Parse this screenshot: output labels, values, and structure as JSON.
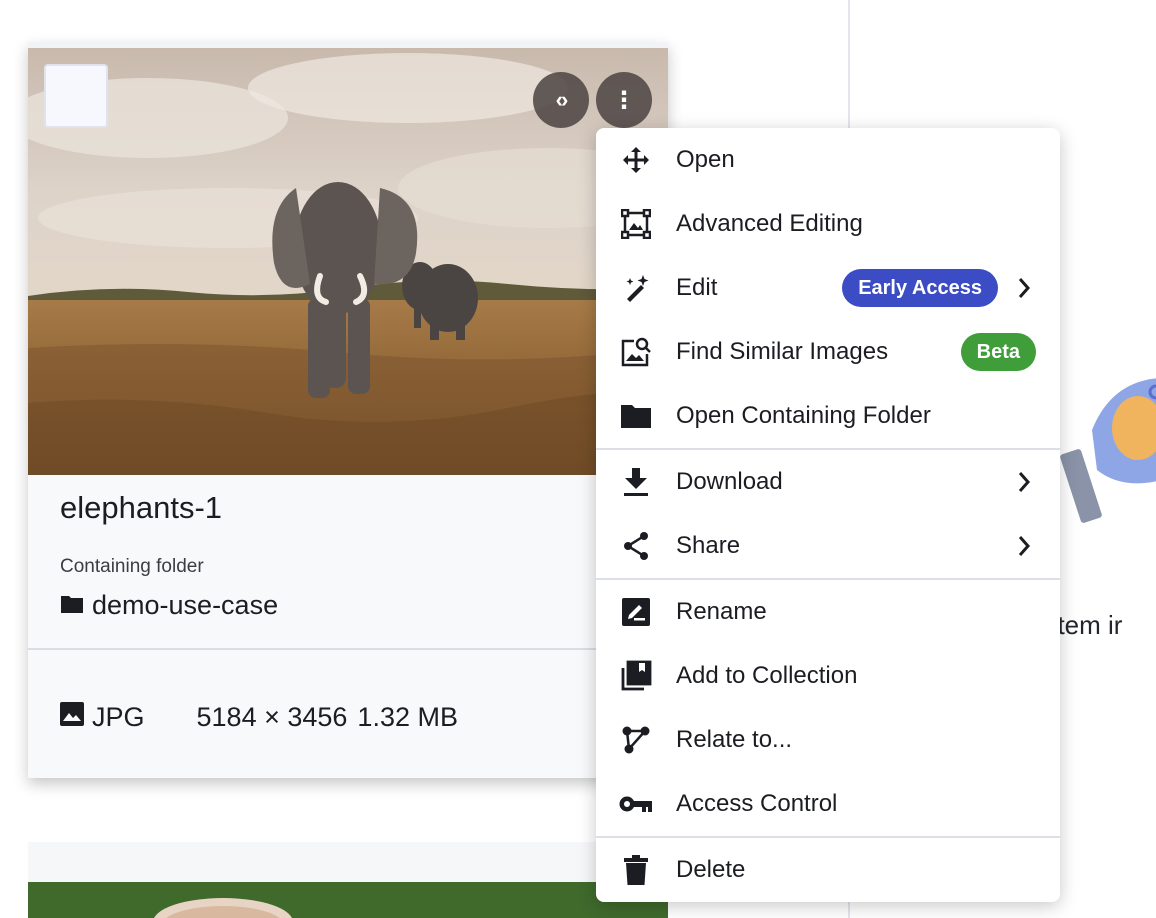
{
  "card": {
    "title": "elephants-1",
    "folder_caption": "Containing folder",
    "folder_name": "demo-use-case",
    "file_type": "JPG",
    "dimensions": "5184 × 3456",
    "file_size": "1.32 MB",
    "code_icon_glyph": "‹›",
    "more_icon_glyph": "⋮"
  },
  "context_menu": {
    "items": [
      {
        "label": "Open",
        "icon": "move-arrows-icon"
      },
      {
        "label": "Advanced Editing",
        "icon": "image-frame-icon"
      },
      {
        "label": "Edit",
        "icon": "magic-wand-icon",
        "badge": "Early Access",
        "badge_color": "#3c4cc4",
        "submenu": true
      },
      {
        "label": "Find Similar Images",
        "icon": "image-search-icon",
        "badge": "Beta",
        "badge_color": "#3f9e3a"
      },
      {
        "label": "Open Containing Folder",
        "icon": "folder-icon"
      },
      {
        "label": "Download",
        "icon": "download-icon",
        "submenu": true
      },
      {
        "label": "Share",
        "icon": "share-icon",
        "submenu": true
      },
      {
        "label": "Rename",
        "icon": "rename-icon"
      },
      {
        "label": "Add to Collection",
        "icon": "collection-icon"
      },
      {
        "label": "Relate to...",
        "icon": "relate-icon"
      },
      {
        "label": "Access Control",
        "icon": "key-icon"
      },
      {
        "label": "Delete",
        "icon": "trash-icon"
      }
    ]
  },
  "right_panel": {
    "partial_text": "n item ir"
  },
  "colors": {
    "early_access": "#3c4cc4",
    "beta": "#3f9e3a",
    "card_bg": "#f8f9fb"
  }
}
